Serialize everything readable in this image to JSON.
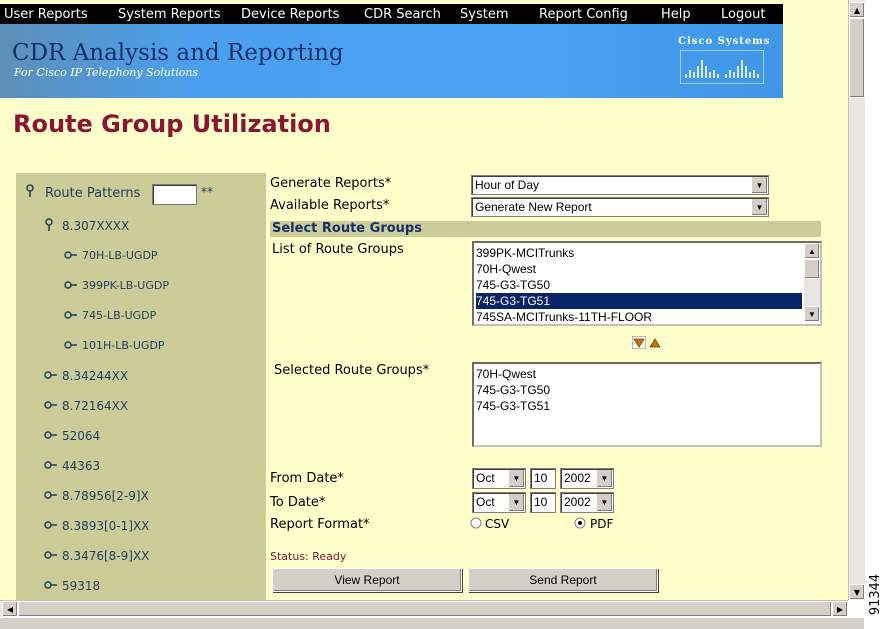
{
  "menu": [
    "User Reports",
    "System Reports",
    "Device Reports",
    "CDR Search",
    "System",
    "Report Config",
    "Help",
    "Logout"
  ],
  "banner": {
    "title": "CDR Analysis and Reporting",
    "subtitle": "For Cisco IP Telephony Solutions",
    "logo_text": "Cisco Systems"
  },
  "page_title": "Route Group Utilization",
  "tree": {
    "root_label": "Route Patterns",
    "root_suffix": "**",
    "root_input_value": "",
    "items": [
      {
        "label": "8.307XXXX",
        "icon": "pin-icon"
      },
      {
        "label": "70H-LB-UGDP",
        "icon": "route-group-icon"
      },
      {
        "label": "399PK-LB-UGDP",
        "icon": "route-group-icon"
      },
      {
        "label": "745-LB-UGDP",
        "icon": "route-group-icon"
      },
      {
        "label": "101H-LB-UGDP",
        "icon": "route-group-icon"
      },
      {
        "label": "8.34244XX",
        "icon": "route-pattern-icon"
      },
      {
        "label": "8.72164XX",
        "icon": "route-pattern-icon"
      },
      {
        "label": "52064",
        "icon": "route-pattern-icon"
      },
      {
        "label": "44363",
        "icon": "route-pattern-icon"
      },
      {
        "label": "8.78956[2-9]X",
        "icon": "route-pattern-icon"
      },
      {
        "label": "8.3893[0-1]XX",
        "icon": "route-pattern-icon"
      },
      {
        "label": "8.3476[8-9]XX",
        "icon": "route-pattern-icon"
      },
      {
        "label": "59318",
        "icon": "route-pattern-icon"
      }
    ]
  },
  "form": {
    "generate_reports_label": "Generate Reports*",
    "generate_reports_value": "Hour of Day",
    "available_reports_label": "Available Reports*",
    "available_reports_value": "Generate New Report",
    "section_title": "Select Route Groups",
    "list_label": "List of Route Groups",
    "route_groups": [
      "399PK-MCITrunks",
      "70H-Qwest",
      "745-G3-TG50",
      "745-G3-TG51",
      "745SA-MCITrunks-11TH-FLOOR"
    ],
    "selected_index": 3,
    "selected_label": "Selected Route Groups*",
    "selected_groups": [
      "70H-Qwest",
      "745-G3-TG50",
      "745-G3-TG51"
    ],
    "from_date_label": "From Date*",
    "from_month": "Oct",
    "from_day": "10",
    "from_year": "2002",
    "to_date_label": "To Date*",
    "to_month": "Oct",
    "to_day": "10",
    "to_year": "2002",
    "report_format_label": "Report Format*",
    "format_csv": "CSV",
    "format_pdf": "PDF",
    "format_selected": "PDF",
    "status": "Status: Ready",
    "view_button": "View Report",
    "send_button": "Send Report"
  },
  "figure_number": "91344",
  "colors": {
    "page_bg": "#ffffcc",
    "tree_bg": "#cccc99",
    "title": "#8b1533",
    "selected_row": "#0a246a",
    "menubar": "#000000"
  }
}
